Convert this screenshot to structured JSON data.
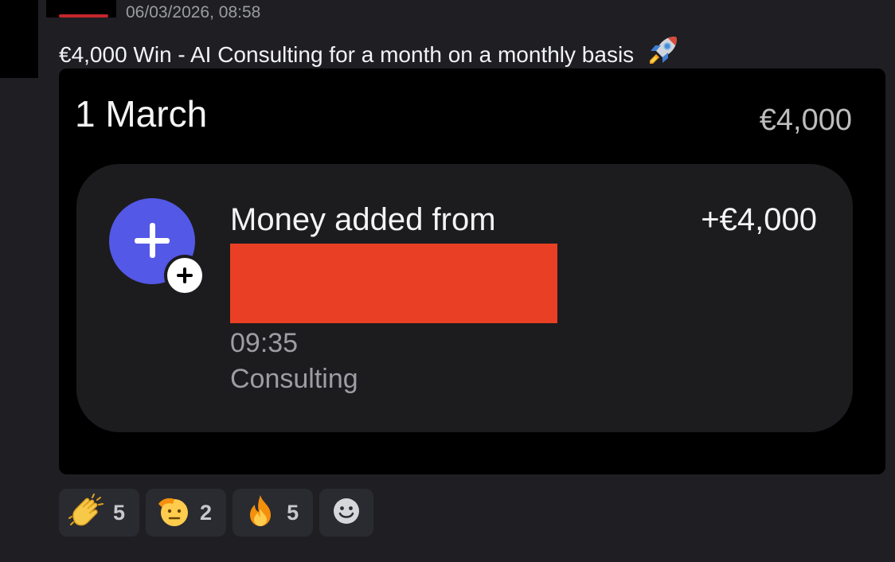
{
  "message": {
    "timestamp": "06/03/2026, 08:58",
    "text": "€4,000 Win - AI Consulting for a month on a monthly basis",
    "trailing_emoji": "rocket-icon"
  },
  "attachment": {
    "date_heading": "1 March",
    "day_total": "€4,000",
    "transaction": {
      "icon": "plus-icon",
      "badge_icon": "plus-badge-icon",
      "title": "Money added from",
      "amount": "+€4,000",
      "time": "09:35",
      "category": "Consulting",
      "redaction_color": "#e94025"
    }
  },
  "reactions": [
    {
      "icon": "clapping-hands-icon",
      "count": "5"
    },
    {
      "icon": "saluting-face-icon",
      "count": "2"
    },
    {
      "icon": "fire-icon",
      "count": "5"
    }
  ],
  "add_reaction_icon": "add-reaction-icon",
  "colors": {
    "background": "#1f1f23",
    "accent_icon": "#5458e6",
    "timestamp": "#9a9ca3"
  }
}
